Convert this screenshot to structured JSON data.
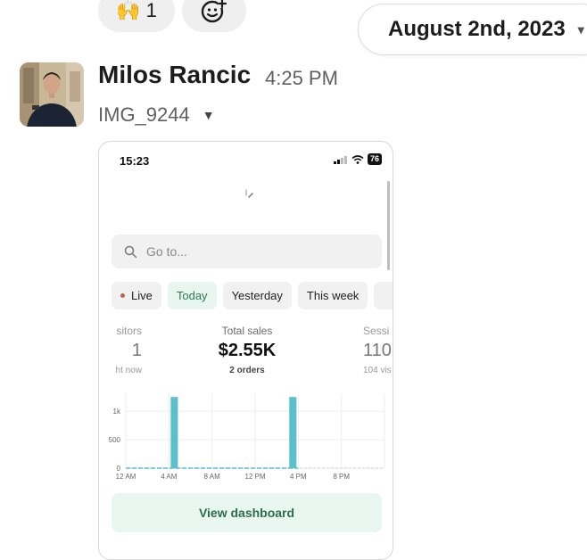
{
  "reactions": [
    {
      "emoji": "🙌",
      "count": "1",
      "icon": "raised-hands-icon"
    },
    {
      "icon": "add-reaction-icon"
    }
  ],
  "date_divider": {
    "label": "August 2nd, 2023"
  },
  "message": {
    "author": "Milos Rancic",
    "time": "4:25 PM",
    "attachment_name": "IMG_9244"
  },
  "phone": {
    "status_time": "15:23",
    "battery": "76",
    "search_placeholder": "Go to...",
    "chips": [
      {
        "label": "Live",
        "live_dot": true
      },
      {
        "label": "Today",
        "active": true
      },
      {
        "label": "Yesterday"
      },
      {
        "label": "This week"
      }
    ],
    "metrics": {
      "visitors": {
        "label": "sitors",
        "value": "1",
        "sub": "ht now"
      },
      "sales": {
        "label": "Total sales",
        "value": "$2.55K",
        "sub": "2 orders"
      },
      "sessions": {
        "label": "Sessi",
        "value": "110",
        "sub": "104 vis"
      }
    },
    "view_dashboard": "View dashboard"
  },
  "chart_data": {
    "type": "bar",
    "x_tick_labels": [
      "12 AM",
      "4 AM",
      "8 AM",
      "12 PM",
      "4 PM",
      "8 PM"
    ],
    "y_tick_labels": [
      "1k",
      "500",
      "0"
    ],
    "ylim": [
      0,
      1300
    ],
    "bar_color": "#5bbfcc",
    "bars": [
      {
        "hour": 4,
        "value": 1250
      },
      {
        "hour": 15,
        "value": 1250
      }
    ],
    "dashed_baseline_until_hour": 16
  }
}
